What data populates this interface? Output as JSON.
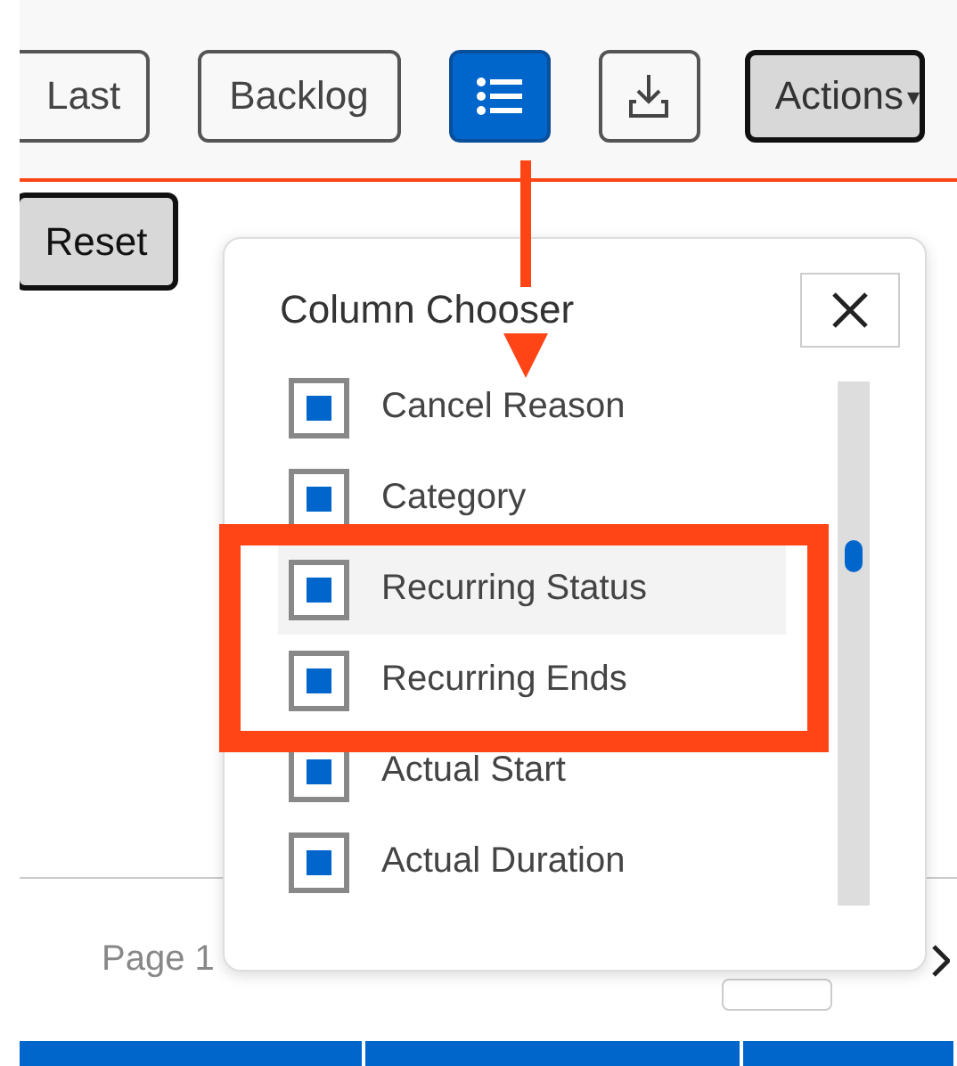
{
  "toolbar": {
    "buttons": [
      {
        "kind": "text",
        "label": "Last",
        "selected": false
      },
      {
        "kind": "text",
        "label": "Backlog",
        "selected": false
      },
      {
        "kind": "list",
        "selected": true
      },
      {
        "kind": "download",
        "selected": false
      },
      {
        "kind": "menu",
        "label": "Actions",
        "caret": "▾",
        "selected": false
      }
    ]
  },
  "reset_button": {
    "label": "Reset"
  },
  "column_chooser": {
    "title": "Column Chooser",
    "columns": [
      {
        "label": "Cancel Reason",
        "checked": true,
        "selected": false
      },
      {
        "label": "Category",
        "checked": true,
        "selected": false
      },
      {
        "label": "Recurring Status",
        "checked": true,
        "selected": true
      },
      {
        "label": "Recurring Ends",
        "checked": true,
        "selected": false
      },
      {
        "label": "Actual Start",
        "checked": true,
        "selected": false
      },
      {
        "label": "Actual Duration",
        "checked": true,
        "selected": false
      }
    ]
  },
  "pagination": {
    "page_label": "Page 1"
  }
}
